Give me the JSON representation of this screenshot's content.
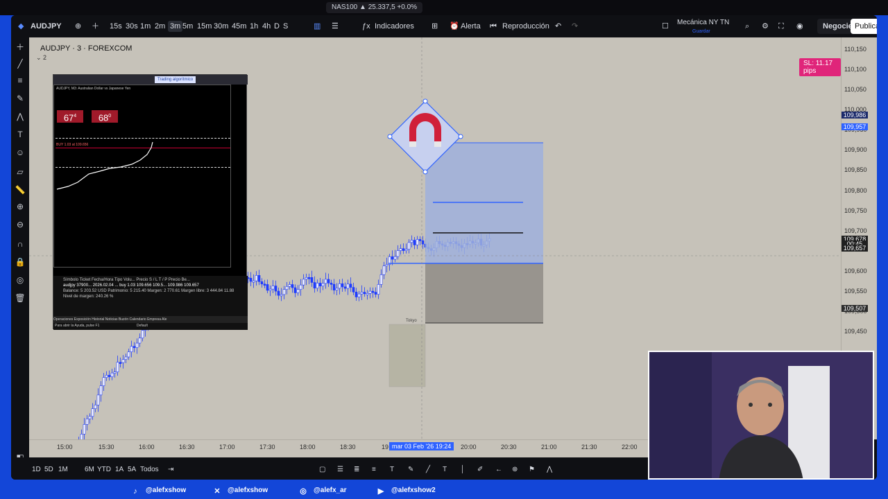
{
  "browser": {
    "tab_label": "NAS100 ▲ 25.337,5 +0.0%"
  },
  "toolbar": {
    "symbol": "AUDJPY",
    "timeframes": [
      "15s",
      "30s",
      "1m",
      "2m",
      "3m",
      "5m",
      "15m",
      "30m",
      "45m",
      "1h",
      "4h",
      "D",
      "S"
    ],
    "selected_timeframe": "3m",
    "indicators_label": "Indicadores",
    "alert_label": "Alerta",
    "replay_label": "Reproducción",
    "layout_name": "Mecánica NY TN",
    "layout_sub": "Guardar",
    "trade_label": "Negocie",
    "publish_label": "Publica"
  },
  "chart": {
    "title": "AUDJPY · 3 · FOREXCOM",
    "panes_count": "2",
    "sl_badge": "SL: 11.17 pips",
    "colors": {
      "background": "#c6c2b9",
      "candle": "#1f3cff",
      "target_zone": "#9fb0dc",
      "stop_zone": "#8f8c86",
      "selection": "#2e62ff"
    }
  },
  "price_axis": {
    "labels": [
      {
        "text": "110,150",
        "price": 110.15
      },
      {
        "text": "110,100",
        "price": 110.1
      },
      {
        "text": "110,050",
        "price": 110.05
      },
      {
        "text": "110,000",
        "price": 110.0
      },
      {
        "text": "109,950",
        "price": 109.95
      },
      {
        "text": "109,900",
        "price": 109.9
      },
      {
        "text": "109,850",
        "price": 109.85
      },
      {
        "text": "109,800",
        "price": 109.8
      },
      {
        "text": "109,750",
        "price": 109.75
      },
      {
        "text": "109,700",
        "price": 109.7
      },
      {
        "text": "109,600",
        "price": 109.6
      },
      {
        "text": "109,550",
        "price": 109.55
      },
      {
        "text": "109,500",
        "price": 109.5
      },
      {
        "text": "109,450",
        "price": 109.45
      }
    ],
    "tags": [
      {
        "text": "109,986",
        "price": 109.986,
        "color": "#1b2a6b"
      },
      {
        "text": "109,957",
        "price": 109.957,
        "color": "#2e62ff"
      },
      {
        "text": "109,678",
        "price": 109.678,
        "color": "#1f1f1f"
      },
      {
        "text": "00:45",
        "price": 109.666,
        "color": "#1f1f1f"
      },
      {
        "text": "109,657",
        "price": 109.657,
        "color": "#1f1f1f"
      },
      {
        "text": "109,507",
        "price": 109.507,
        "color": "#2b2b2b"
      }
    ]
  },
  "time_axis": {
    "labels": [
      "15:00",
      "15:30",
      "16:00",
      "16:30",
      "17:00",
      "17:30",
      "18:00",
      "18:30",
      "20:00",
      "20:30",
      "21:00",
      "21:30",
      "22:00"
    ],
    "crosshair_label": "mar 03 Feb '26   19:24",
    "partial_label": "19"
  },
  "bottom_bar": {
    "ranges": [
      "1D",
      "5D",
      "1M",
      "6M",
      "YTD",
      "1A",
      "5A",
      "Todos"
    ]
  },
  "mt_window": {
    "toolbar_label": "Trading algorítmico",
    "pair_line": "AUDJPY, M3: Australian Dollar vs Japanese Yen",
    "sell_price": "67",
    "sell_sup": "4",
    "buy_price": "68",
    "buy_sup": "0",
    "order_line": "BUY 1.03 at 109.656",
    "terminal_headers": "Símbolo   Ticket   Fecha/Hora   Tipo   Volu...   Precio   S / L   T / P   Precio   Be...",
    "position_row": "audjpy   37900...   2026.02.04 ...   buy   1.03   109.656 109.5...   109.986   109.657",
    "balance_row": "Balance: 5 203.52 USD  Patrimonio: 5 215.40  Margen: 2 770.61  Margen libre: 3 444.84   11.88",
    "margin_row": "Nivel de margen: 240.26 %",
    "tabs": "Operaciones   Exposición   Historial   Noticias   Buzón   Calendario   Empresa   Ale",
    "status": "Para abrir la Ayuda, pulse F1",
    "status_right": "Default"
  },
  "socials": [
    {
      "icon": "tiktok-icon",
      "handle": "@alefxshow"
    },
    {
      "icon": "x-icon",
      "handle": "@alefxshow"
    },
    {
      "icon": "instagram-icon",
      "handle": "@alefx_ar"
    },
    {
      "icon": "youtube-icon",
      "handle": "@alefxshow2"
    }
  ],
  "session_label": "Tokyo",
  "watermark": "TV"
}
